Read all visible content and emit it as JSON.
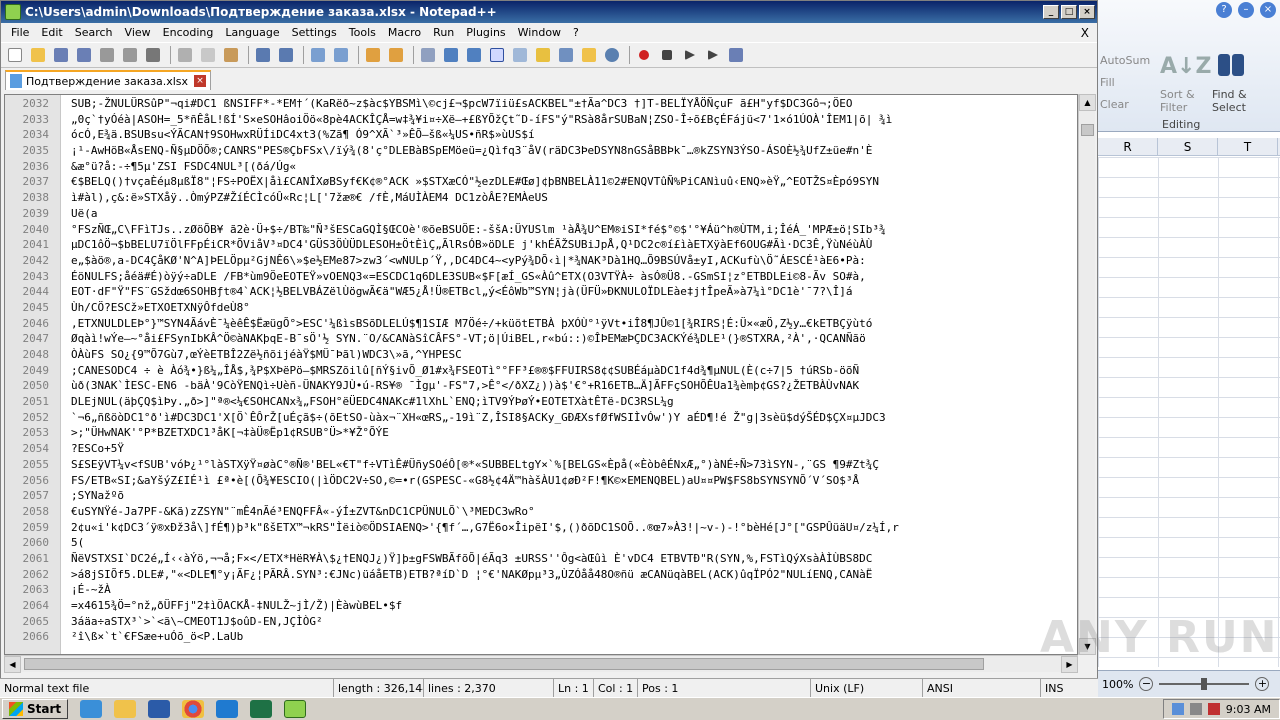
{
  "window": {
    "title": "C:\\Users\\admin\\Downloads\\Подтверждение заказа.xlsx - Notepad++",
    "minimize": "_",
    "maximize": "□",
    "close": "×"
  },
  "menu": [
    "File",
    "Edit",
    "Search",
    "View",
    "Encoding",
    "Language",
    "Settings",
    "Tools",
    "Macro",
    "Run",
    "Plugins",
    "Window",
    "?"
  ],
  "menu_close": "X",
  "tab": {
    "label": "Подтверждение заказа.xlsx",
    "close": "×"
  },
  "editor": {
    "lines": [
      {
        "n": "2032",
        "text": "SUB;-ŽNULÜRSûP\"¬qi#DC1 ßNSIFF*-*EM†´(KaRëð~z$àc$YBSMì\\©cj£¬$pcW7ïiü£sACKBEL\"±†Ãa^DC3 †]T-BELÏYÅÖÑçuF ã£H\"yf$DC3Gô¬;ÖEO"
      },
      {
        "n": "2033",
        "text": "„0ç`†yÓéà|ASOH=_5*ñÊåL!ßÍ'S×eSOHâoiÖö«8pè4ACKÎÇÅ=w‡¾¥i¤÷Xë—+£ßYÕžÇt˜D-íFS\"ý\"RSà8årSUBaN¦ZSO-Î÷õ£BçÉFájü<7'1×ó1ÚOÀ'ÎEM1|õ| ¾ì"
      },
      {
        "n": "2034",
        "text": "ócÓ,E¾ä.BSUBsu<ÝÃCAN†9SOHwxRÜÍiDC4xt3(%Zã¶ Ó9^XÃ`³»ÊÕ—šß«¼US•ñR$»ùUS$í"
      },
      {
        "n": "2035",
        "text": "¡¹-AwHöB«ÅsENQ-Ñ§µDÖÕ®;CANRS\"PES®ÇbFSx\\/ïý¾(8'ç°DLEBàBSpEMöeü=¿Qìfq3¨åV(räDC3ÞeDSYN8nGSåBBÞk¯…®kZSYN3ÝSO-ÁSOÈ½¾UfZ±üe#n'È"
      },
      {
        "n": "2036",
        "text": "&æ°ü?å:-÷¶5µ'ZSI FSDC4NUL³[(ðá/Úg«"
      },
      {
        "n": "2037",
        "text": "€$BELQ()†vçaÈéµ8µßÏ8\"¦FS÷POËX|åì£CANÎXøBSyf€K¢®°ACK »$STXæCÓ\"½ezDLE#Œø]¢þBNBELÀ11©2#ENQVTûÑ%PiCANìuû‹ENQ»èŸ„^EOTŽS¤Èpó9SYN"
      },
      {
        "n": "2038",
        "text": "ì#àl),ç&:ë»STXåÿ..ÒmýPZ#ŽíÉCÌcóÛ«Rc¦L['7žæ®€ /fÈ,MáUÌÀEM4 DC1zòÂE?EMÀeUS"
      },
      {
        "n": "2039",
        "text": "Uë(a"
      },
      {
        "n": "2040",
        "text": "°FSzÑŒ„C\\FFìTJs..zØöÕB¥ ã2è·Ü+$÷/BT‰\"Ñ³šESCaGQÌ§ŒCOè'®õeBSUÖE:-ššA:ÜYUSlm  ¹àÅ¾U^EM®iSI*fé$°©$'°¥Áü^h®ÙTM,i;ÎéÁ_'MPÆ±ö¦SIb³¾"
      },
      {
        "n": "2041",
        "text": "µDC1ôÖ¬$bBELU7ïÖlFFpÉiCR*ÕViåV³¤DC4'GÜS3ÖÙÜDLESOH±Öt­ÈìÇ„ÃlRsÓB»öDLE j'khÉÃŽSUBiJpÅ,Q¹DC2c®í£ìàETXÿàEf6OUG#Ãì·DC3Ê,ŸùNéùÀÙ"
      },
      {
        "n": "2042",
        "text": "e„$àö®,a-DC4ÇåKØ'N^A]ÞELÖpµ²GjNÊ6\\»$e½EMe87>zw3´<wNULp´Ÿ,,DC4DC4~<yPý¾DÕ‹ì|*¾NAK³Dà1HQ…Õ9BSÚVå±yI,ACKufù\\Ö˜ÁESCÉ¹àE6•Pà:"
      },
      {
        "n": "2043",
        "text": "ÉöNULFS;åéä#É)òÿý÷aDLE /FB*ùm9ÖeEOTEŸ»vOENQ3«=ESCDC1q6DLE3SUB«$F[æÍ_GS«Àû^ETX(O3VTŸÀ÷ àsÓ®Ü8.-GSmSI¦z°ETBDLEi©8-Ãv SO#à,"
      },
      {
        "n": "2044",
        "text": "EOT·dF\"Ÿ\"FS¨GSždœ6SOHBƒt®4`ACK¦½BELVBÁZëlÙögwÃ€ä\"WÆ5¿Å!Ü®ETBcl„ý<ÉôWb™SYN¦jà(ÜFÜ»ÐKNULOÏDLEàe‡j†ÎpeÃ»à7¼ì°DC1è'¯7?\\Î]á"
      },
      {
        "n": "2045",
        "text": "Ùh/CÖ?ESCž»ETXOETXNÿÔfdeÙ8°"
      },
      {
        "n": "2046",
        "text": ",ETXNULDLEÞ°}™SYN4ÃávÈ¯¼èêÊ$ËæügÕ°>ESC'¼ßìsBSõDLELÚ$¶1SIÆ M7Öé÷/+küötETBÀ þXÓÙ°¹ÿVt•iÎ8¶JÛ©1[¾RIRS¦É:Ü×«æÖ,Z½y…€kETBÇÿùtó"
      },
      {
        "n": "2047",
        "text": "Øqàì!wÝe—~°åi£FSynIbKÂ^Ö©àNAKþqE-B¯sÖ'½ SYN.¨O/&CANàSîCÂFS°-VT;ö|ÚiBEL,r«bú::)©ÎÞEMæÞÇDC3ACKÝé¾DLE¹(}®STXRA,²À',·QCANÑãö"
      },
      {
        "n": "2048",
        "text": "ÒÀùFS SO¿{9™Õ7Gù7,œÝèETBÎ2Zë½ñõijéàŸ$MÜ¯Þãl)WDC3\\»ã,^YHPESC"
      },
      {
        "n": "2049",
        "text": ";CANESODC4 ÷ è Àó¾•}ß¼„ÎÅ$,¾P$XÞëPö—$MRSZõilû[ñÝ§ivÕ_Ø1#x¾FSEOTì°°FF³£®®$FFUIRS8¢¢SUBÉáµàDC1f4d¾¶µNUL(È(c÷7|5 †úRSb-öõÑ"
      },
      {
        "n": "2050",
        "text": "ùð(3NAK`ÌESC-EN6 -bäÀ'9CòŸENQì÷Uèñ-ÜNAKY9JÙ•ú-RS¥® ¯Ìgµ'-FS\"7,>Ê°</ðXZ¿))à$'€°+R16ETB…Ä]ÃFFçSOHÕÊUa1¾èmþ¢GS?¿ŽETBÀÙvNAK"
      },
      {
        "n": "2051",
        "text": "DLEjNUL(äþÇQ$ìÞy.„ð>]\"ª®<¼€SOHCANx¾„FSOH°ëÜEDC4NAKc#1lXhL`ENQ;ìTV9ÝÞøÝ•EOTETXàtÊTë-DC3RSL¼g"
      },
      {
        "n": "2052",
        "text": "`¬6„ñßöòDC1°ð'ì#DC3DC1'X[Ö`ÊÔrŽ[uÉçã$÷(õEtSO-ùàx¬¨XH«œRS„-19ì¨Z,ÎSI8§ACKy_GÐÆXsfØfWSIÌvÓw')Y aÉD¶!é Ž\"g|3sèü$dýŠÉD$ÇX¤µJDC3"
      },
      {
        "n": "2053",
        "text": ">;\"ÜHwNAK'°P*BZETXDC1³åK[¬‡àÜ®Ëp1¢RSUB°Ü>*¥Ž°ÕÝE"
      },
      {
        "n": "2054",
        "text": "?ESCo+5Ÿ"
      },
      {
        "n": "2055",
        "text": "S£SEÿVT¼v<fSUB'vóÞ¿¹°làSTXÿŸ¤øàC°®Ñ®'BEL«€T\"f÷VTìÊ#ÜñySOéÔ[®*«SUBBELtgY×`%[BELGS«Èpå(«ÈòbêÉNxÆ„°)àNÉ÷Ñ>73ìSYN-,¨GS ¶9#Zt¾Ç"
      },
      {
        "n": "2056",
        "text": "FS/ETB«SI;&aYšýZ£IÉ¹ì  £ª•è[(Õ¾¥ESCIO(|ìÖDC2V÷SO,©=•r(GSPESC-«G8½¢4Ä™hàšÀU1¢øÐ²F!¶K©×EMENQBEL)aU¤¤PW$FS8bSYNSYNÕ´V´SO$³Å"
      },
      {
        "n": "2057",
        "text": ";SYNažºõ"
      },
      {
        "n": "2058",
        "text": "€uSYNŸé-Ja7PF-&Kã)zZSYN\"¨mÊ4nÃé³ENQFFÂ«-ýÍ±ZVT&nDC1CPÜNULÕ`\\³MEDC3wRo°"
      },
      {
        "n": "2059",
        "text": "2¢u«i'k¢DC3´ÿ®xÐž3å\\]fÉ¶)þ³k\"ßšETX™¬kRS\"Ìëiò©ÖDSIAENQ>'{¶f´…,G7Ë6o×ÎipëI'$,()ðõDC1SOÕ..®œ7»À3!|~v-)-!°bèHé[J°[\"GSPÛüäU¤/z¼Í,r"
      },
      {
        "n": "2060",
        "text": "5("
      },
      {
        "n": "2061",
        "text": "ÑëVSTXSI`DC2é„Í‹‹àÝö,¬¬å;F×</ETX*HëR¥À\\$¿†ENQJ¿)Ÿ]þ±gFSWBÃfõÕ|éÃq3 ±URSS''Ôg<àŒûì È'vDC4  ETBVTÐ\"R(SYN,%,FSTìQýXsàÀÌÙBS8DC"
      },
      {
        "n": "2062",
        "text": ">á8jSIÕf5.DLE#,\"«<DLE¶°y¡ÃF¿¦PÃRÂ.SYN³:€JNc)üáåETB)ETB?ªíD`D  ¦°€'NAKØpµ³3„ÙZÓåå48O®ñü æCANüqàBEL(ACK)ûqÏPÓ2\"NULíENQ,CANàË"
      },
      {
        "n": "2063",
        "text": "¡É-~žÀ"
      },
      {
        "n": "2064",
        "text": "=x4615¾Ö=°nž„ðÜFFj\"2‡ìÖACKÅ-‡NULŽ~jÌ/Ž)|ÈàwùBEL•$f"
      },
      {
        "n": "2065",
        "text": "3áäa÷aSTX³`>`<ã\\~CMEOT1J$oûD-EN,JÇÌÒG²"
      },
      {
        "n": "2066",
        "text": "²î\\ß×`t`€FSæe+uÓõ_ö<P.LaUb"
      }
    ]
  },
  "status": {
    "filetype": "Normal text file",
    "length": "length : 326,144",
    "lines": "lines : 2,370",
    "ln": "Ln : 1",
    "col": "Col : 1",
    "pos": "Pos : 1",
    "eol": "Unix (LF)",
    "encoding": "ANSI",
    "mode": "INS"
  },
  "excel": {
    "autosum": "AutoSum",
    "fill": "Fill",
    "clear": "Clear",
    "sort_label_1": "Sort &",
    "sort_label_2": "Filter",
    "find_label_1": "Find &",
    "find_label_2": "Select",
    "group": "Editing",
    "columns": [
      "R",
      "S",
      "T"
    ],
    "zoom": "100%"
  },
  "watermark": "ANY RUN",
  "taskbar": {
    "start": "Start",
    "clock": "9:03 AM"
  }
}
